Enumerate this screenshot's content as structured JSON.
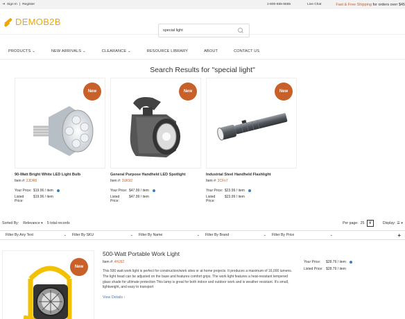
{
  "topbar": {
    "sign_in": "Sign In",
    "separator": "|",
    "register": "Register",
    "phone": "1-800-555-5555",
    "live_chat": "Live Chat",
    "shipping_highlight": "Fast & Free Shipping",
    "shipping_rest": " for orders over $45"
  },
  "logo": {
    "part1": "DEMO",
    "part2": "B2B"
  },
  "search": {
    "value": "special light"
  },
  "nav": {
    "products": "PRODUCTS ⌄",
    "new_arrivals": "NEW ARRIVALS ⌄",
    "clearance": "CLEARANCE ⌄",
    "resource_library": "RESOURCE LIBRARY",
    "about": "ABOUT",
    "contact": "CONTACT US"
  },
  "results_title": "Search Results for \"special light\"",
  "badge": "New",
  "labels": {
    "item_num": "Item #:",
    "your_price": "Your Price:",
    "listed_price": "Listed Price:",
    "view_details": "View Details ›"
  },
  "cards": [
    {
      "name": "90-Watt Bright White LED Light Bulb",
      "item": "2JDR8",
      "your_price": "$19.96 / item",
      "listed_price": "$19.96 / item"
    },
    {
      "name": "General Purpose Handheld LED Spotlight",
      "item": "3UK92",
      "your_price": "$47.99 / item",
      "listed_price": "$47.99 / item"
    },
    {
      "name": "Industrial Steel Handheld Flashlight",
      "item": "2CFn7",
      "your_price": "$23.99 / item",
      "listed_price": "$23.99 / item"
    }
  ],
  "sortbar": {
    "sorted_by": "Sorted By:",
    "sort_value": "Relevance ▾",
    "total": "5 total records",
    "per_page": "Per page:",
    "per_page_value": "25",
    "per_page_chev": "▾",
    "display": "Display:",
    "display_icon": "☰ ▾"
  },
  "filters": [
    {
      "label": "Filter By Any Text"
    },
    {
      "label": "Filter By SKU"
    },
    {
      "label": "Filter By Name"
    },
    {
      "label": "Filter By Brand"
    },
    {
      "label": "Filter By Price"
    }
  ],
  "filter_plus": "+",
  "result": {
    "name": "500-Watt Portable Work Light",
    "item": "4HJ92",
    "description": "This 500 watt work light is perfect for construction/work sites or at home projects. It produces a maximum of 16,000 lumens. The light head can be adjusted on the base and features comfort grips. The work light features a heat-resistant tempered glass shade for ultimate protection This lamp is great for both indoor and outdoor work and is weather resistant. It's small, lightweight, and easy to transport",
    "your_price": "$28.79 / item",
    "listed_price": "$28.79 / item"
  },
  "colors": {
    "accent": "#c8602a",
    "logo": "#f0a500",
    "link": "#3b7fc4"
  }
}
